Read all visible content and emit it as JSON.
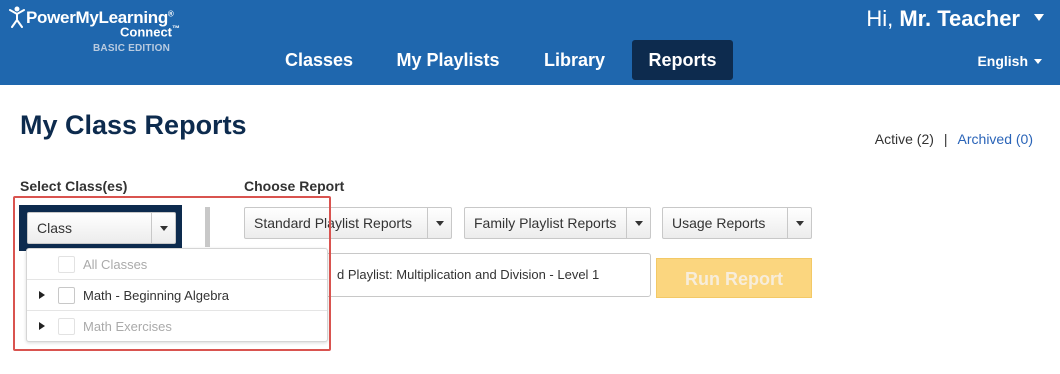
{
  "brand": {
    "name": "PowerMyLearning",
    "trademark": "®",
    "product": "Connect",
    "product_trademark": "™",
    "edition": "BASIC EDITION"
  },
  "nav": {
    "items": [
      {
        "label": "Classes",
        "active": false
      },
      {
        "label": "My Playlists",
        "active": false
      },
      {
        "label": "Library",
        "active": false
      },
      {
        "label": "Reports",
        "active": true
      }
    ]
  },
  "user": {
    "greeting": "Hi,",
    "name": "Mr. Teacher"
  },
  "language": {
    "selected": "English"
  },
  "page": {
    "title": "My Class Reports",
    "active_label": "Active (2)",
    "separator": "|",
    "archived_label": "Archived (0)"
  },
  "class_select": {
    "label": "Select Class(es)",
    "selected": "Class",
    "options": [
      {
        "label": "All Classes",
        "enabled": false,
        "expandable": false
      },
      {
        "label": "Math - Beginning Algebra",
        "enabled": true,
        "expandable": true
      },
      {
        "label": "Math Exercises",
        "enabled": false,
        "expandable": true
      }
    ]
  },
  "report": {
    "label": "Choose Report",
    "selects": [
      "Standard Playlist Reports",
      "Family Playlist Reports",
      "Usage Reports"
    ],
    "playlist_value": "d Playlist: Multiplication and Division - Level 1",
    "run_label": "Run Report"
  },
  "colors": {
    "header_bg": "#1f67ae",
    "nav_active_bg": "#0d2b4e",
    "title": "#0d2b4e",
    "link": "#2a64b8",
    "highlight": "#d9534f",
    "run_button": "#fbd67f"
  }
}
